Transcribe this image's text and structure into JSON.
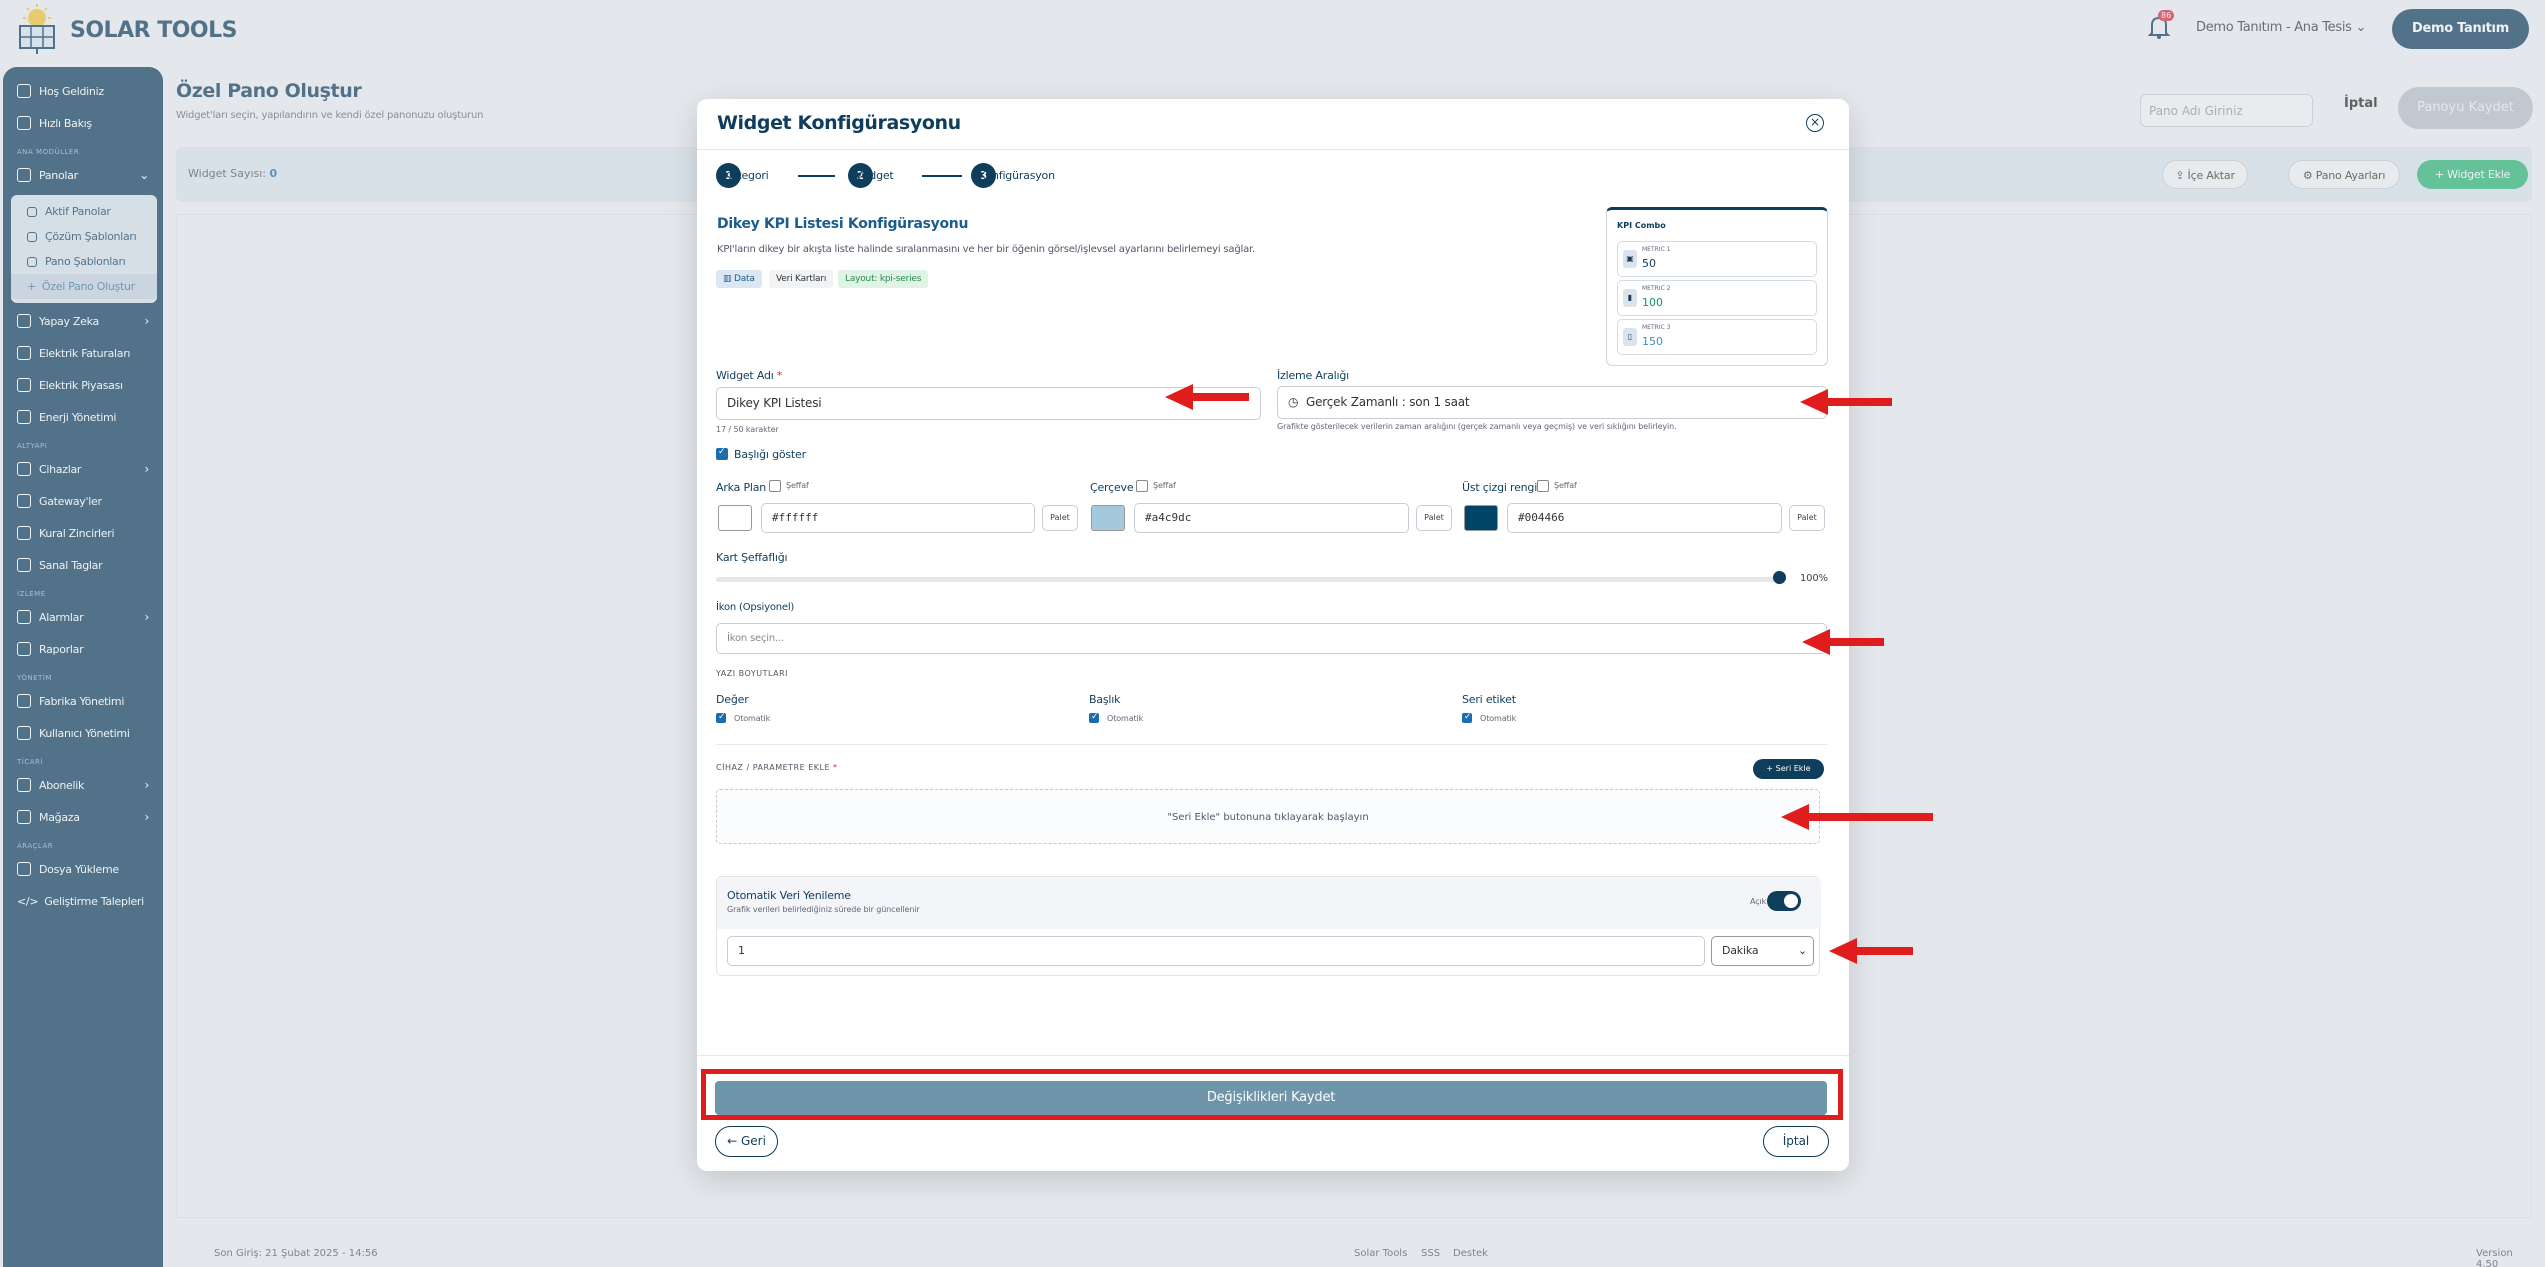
{
  "brand": {
    "name": "SOLAR TOOLS"
  },
  "header": {
    "notification_count": "86",
    "tenant": "Demo Tanıtım - Ana Tesis",
    "user_button": "Demo Tanıtım"
  },
  "sidebar": {
    "items_top": [
      "Hoş Geldiniz",
      "Hızlı Bakış"
    ],
    "section_ana": "ANA MODÜLLER",
    "panolar": "Panolar",
    "panolar_sub": [
      "Aktif Panolar",
      "Çözüm Şablonları",
      "Pano Şablonları",
      "Özel Pano Oluştur"
    ],
    "items_ana": [
      "Yapay Zeka",
      "Elektrik Faturaları",
      "Elektrik Piyasası",
      "Enerji Yönetimi"
    ],
    "section_altyapi": "ALTYAPI",
    "items_altyapi": [
      "Cihazlar",
      "Gateway'ler",
      "Kural Zincirleri",
      "Sanal Taglar"
    ],
    "section_izleme": "İZLEME",
    "items_izleme": [
      "Alarmlar",
      "Raporlar"
    ],
    "section_yonetim": "YÖNETİM",
    "items_yonetim": [
      "Fabrika Yönetimi",
      "Kullanıcı Yönetimi"
    ],
    "section_ticari": "TİCARİ",
    "items_ticari": [
      "Abonelik",
      "Mağaza"
    ],
    "section_araclar": "ARAÇLAR",
    "items_araclar": [
      "Dosya Yükleme",
      "Geliştirme Talepleri"
    ]
  },
  "page": {
    "title": "Özel Pano Oluştur",
    "subtitle": "Widget'ları seçin, yapılandırın ve kendi özel panonuzu oluşturun",
    "name_placeholder": "Pano Adı Giriniz",
    "cancel": "İptal",
    "save": "Panoyu Kaydet",
    "widget_count_label": "Widget Sayısı:",
    "widget_count": "0",
    "import": "İçe Aktar",
    "settings": "Pano Ayarları",
    "add_widget": "Widget Ekle"
  },
  "footer": {
    "last_login": "Son Giriş: 21 Şubat 2025 - 14:56",
    "links": [
      "Solar Tools",
      "SSS",
      "Destek"
    ],
    "version": "Version 4.50"
  },
  "modal": {
    "title": "Widget Konfigürasyonu",
    "steps": [
      "Kategori",
      "Widget",
      "Konfigürasyon"
    ],
    "section_title": "Dikey KPI Listesi Konfigürasyonu",
    "section_desc": "KPI'ların dikey bir akışta liste halinde sıralanmasını ve her bir öğenin görsel/işlevsel ayarlarını belirlemeyi sağlar.",
    "tags": [
      "Data",
      "Veri Kartları",
      "Layout: kpi-series"
    ],
    "preview": {
      "title": "KPI Combo",
      "rows": [
        {
          "name": "METRIC 1",
          "value": "50"
        },
        {
          "name": "METRIC 2",
          "value": "100"
        },
        {
          "name": "METRIC 3",
          "value": "150"
        }
      ]
    },
    "widget_name_label": "Widget Adı",
    "widget_name_value": "Dikey KPI Listesi",
    "widget_name_counter": "17 / 50 karakter",
    "range_label": "İzleme Aralığı",
    "range_value": "Gerçek Zamanlı : son 1 saat",
    "range_help": "Grafikte gösterilecek verilerin zaman aralığını (gerçek zamanlı veya geçmiş) ve veri sıklığını belirleyin.",
    "show_title": "Başlığı göster",
    "colors": [
      {
        "label": "Arka Plan",
        "transparent": "Şeffaf",
        "hex": "#ffffff",
        "color": "#ffffff",
        "palette": "Palet"
      },
      {
        "label": "Çerçeve",
        "transparent": "Şeffaf",
        "hex": "#a4c9dc",
        "color": "#a4c9dc",
        "palette": "Palet"
      },
      {
        "label": "Üst çizgi rengi",
        "transparent": "Şeffaf",
        "hex": "#004466",
        "color": "#004466",
        "palette": "Palet"
      }
    ],
    "opacity_label": "Kart Şeffaflığı",
    "opacity_value": "100%",
    "opacity_level": 100,
    "icon_label": "İkon (Opsiyonel)",
    "icon_placeholder": "İkon seçin...",
    "font_sizes_title": "YAZI BOYUTLARI",
    "font_sizes": [
      {
        "label": "Değer",
        "auto": "Otomatik"
      },
      {
        "label": "Başlık",
        "auto": "Otomatik"
      },
      {
        "label": "Seri etiket",
        "auto": "Otomatik"
      }
    ],
    "device_label": "CİHAZ / PARAMETRE EKLE",
    "add_series": "Seri Ekle",
    "empty_hint": "\"Seri Ekle\" butonuna tıklayarak başlayın",
    "refresh_title": "Otomatik Veri Yenileme",
    "refresh_desc": "Grafik verileri belirlediğiniz sürede bir güncellenir",
    "refresh_toggle": "Açık",
    "refresh_value": "1",
    "refresh_unit": "Dakika",
    "save_changes": "Değişiklikleri Kaydet",
    "back": "← Geri",
    "cancel": "İptal"
  },
  "colors": {
    "primary": "#0f3d5c",
    "accent_green": "#2bb673",
    "annotation_red": "#e01d1d"
  }
}
